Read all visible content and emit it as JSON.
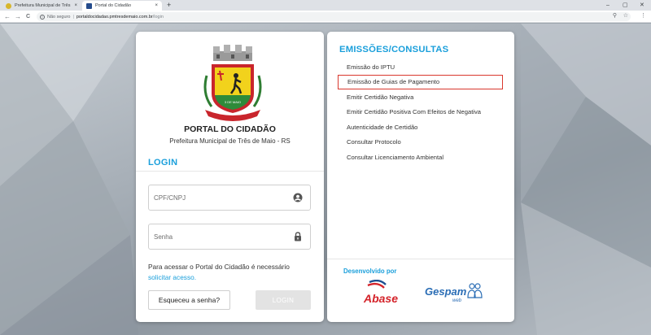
{
  "browser": {
    "tabs": [
      {
        "label": "Prefeitura Municipal de Três de M",
        "close": "×"
      },
      {
        "label": "Portal do Cidadão",
        "close": "×"
      }
    ],
    "new_tab": "+",
    "window_controls": {
      "minimize": "–",
      "maximize": "▢",
      "close": "✕"
    },
    "nav": {
      "back": "←",
      "forward": "→",
      "reload": "C"
    },
    "address": {
      "security_label": "Não seguro",
      "separator": "|",
      "host": "portaldocidadao.pmtresdemaio.com.br",
      "path": "/login"
    },
    "toolbar_icons": {
      "zoom": "⚲",
      "bookmark": "☆",
      "menu": "⋮"
    }
  },
  "login_card": {
    "crest_caption": "3 DE MAIO",
    "title": "PORTAL DO CIDADÃO",
    "subtitle": "Prefeitura Municipal de Três de Maio - RS",
    "heading": "LOGIN",
    "cpf_placeholder": "CPF/CNPJ",
    "password_placeholder": "Senha",
    "info_text": "Para acessar o Portal do Cidadão é necessário",
    "info_link": "solicitar acesso.",
    "forgot_button": "Esqueceu a senha?",
    "login_button": "LOGIN"
  },
  "services_card": {
    "heading": "EMISSÕES/CONSULTAS",
    "items": [
      {
        "label": "Emissão do IPTU"
      },
      {
        "label": "Emissão de Guias de Pagamento"
      },
      {
        "label": "Emitir Certidão Negativa"
      },
      {
        "label": "Emitir Certidão Positiva Com Efeitos de Negativa"
      },
      {
        "label": "Autenticidade de Certidão"
      },
      {
        "label": "Consultar Protocolo"
      },
      {
        "label": "Consultar Licenciamento Ambiental"
      }
    ],
    "highlighted_item": "Emissão de Guias de Pagamento",
    "developed_by": "Desenvolvido por",
    "abase_logo": "Abase",
    "gespam_logo": "Gespam",
    "gespam_sub": "web"
  },
  "colors": {
    "accent": "#1a9fdb",
    "highlight_border": "#d9382e",
    "abase_red": "#d4232a",
    "abase_blue": "#1d4f91",
    "gespam_blue": "#2a6db5"
  }
}
